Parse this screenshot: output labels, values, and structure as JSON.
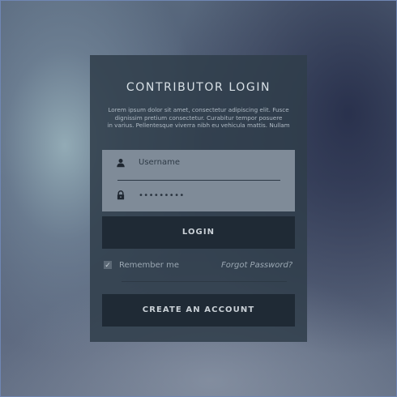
{
  "login_card": {
    "title": "CONTRIBUTOR LOGIN",
    "description_lines": [
      "Lorem ipsum dolor sit amet, consectetur adipiscing elit. Fusce",
      "dignissim pretium consectetur. Curabitur tempor posuere",
      "in varius. Pellentesque viverra nibh eu vehicula mattis. Nullam"
    ],
    "username": {
      "placeholder": "Username",
      "icon": "user-icon"
    },
    "password": {
      "value": "•••••••••",
      "icon": "lock-icon"
    },
    "login_button": "LOGIN",
    "remember_me": {
      "label": "Remember me",
      "checked": true,
      "check_glyph": "✓"
    },
    "forgot_password": "Forgot Password?",
    "create_account_button": "CREATE AN ACCOUNT"
  },
  "colors": {
    "background_light": "#9fb4bc",
    "background_dark": "#2e3552",
    "card": "#303e4a",
    "field_panel": "#7f8b98",
    "button": "#1f2a35",
    "button_text": "#c9d0d6",
    "frame": "#6f86b3"
  }
}
